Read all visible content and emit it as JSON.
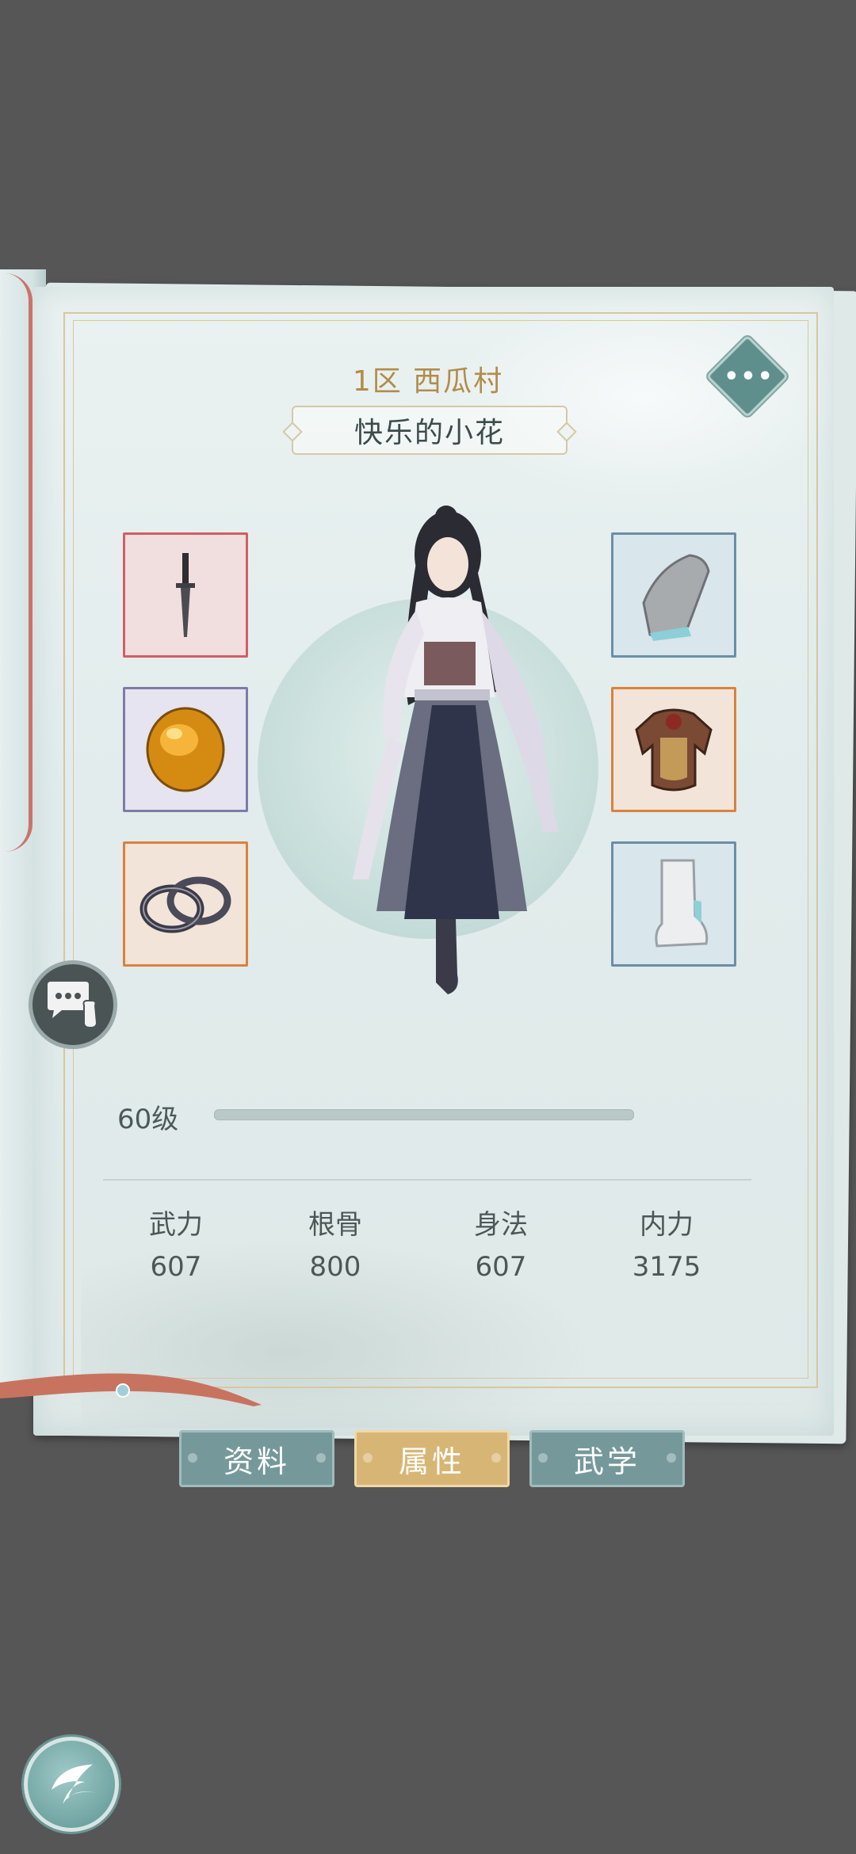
{
  "header": {
    "server": "1区  西瓜村",
    "character_name": "快乐的小花"
  },
  "icons": {
    "more": "more-icon",
    "chat": "chat-bubble-icon",
    "back": "back-arrow-icon"
  },
  "more_label": "•••",
  "equipment": {
    "left": [
      {
        "name": "dagger-icon",
        "rarity_color": "#d25e66"
      },
      {
        "name": "amber-gem-icon",
        "rarity_color": "#7e7ca6"
      },
      {
        "name": "bracelet-icon",
        "rarity_color": "#d9823e"
      }
    ],
    "right": [
      {
        "name": "bracer-icon",
        "rarity_color": "#6b8ea6"
      },
      {
        "name": "armor-icon",
        "rarity_color": "#d9823e"
      },
      {
        "name": "boot-icon",
        "rarity_color": "#6b8ea6"
      }
    ]
  },
  "level": {
    "label": "60级",
    "progress": 0.0
  },
  "stats": [
    {
      "label": "武力",
      "value": "607"
    },
    {
      "label": "根骨",
      "value": "800"
    },
    {
      "label": "身法",
      "value": "607"
    },
    {
      "label": "内力",
      "value": "3175"
    }
  ],
  "tabs": [
    {
      "label": "资料",
      "active": false
    },
    {
      "label": "属性",
      "active": true
    },
    {
      "label": "武学",
      "active": false
    }
  ],
  "colors": {
    "background": "#565656",
    "accent_gold": "#d7b675",
    "tab_teal": "#75999a",
    "title_gold": "#b28c4b"
  }
}
